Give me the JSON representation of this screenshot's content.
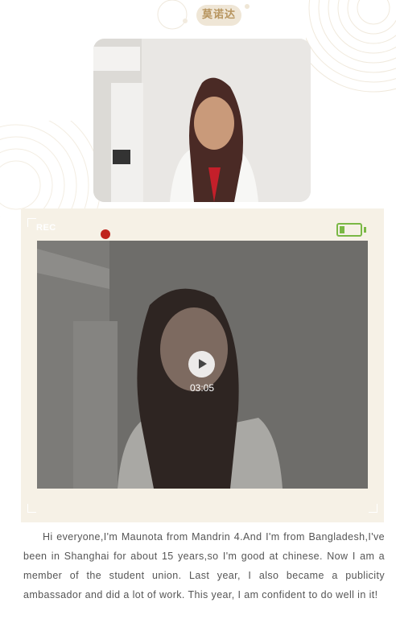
{
  "header": {
    "name": "莫诺达"
  },
  "photo": {
    "alt": "student portrait photo"
  },
  "video": {
    "rec_label": "REC",
    "duration": "03:05",
    "battery_level": 0.25,
    "colors": {
      "rec_dot": "#c0241d",
      "battery": "#7ab845",
      "panel": "#f6f1e6"
    }
  },
  "bio": {
    "text": "Hi everyone,I'm Maunota from Mandrin 4.And I'm from Bangladesh,I've been in Shanghai for about 15 years,so I'm good at chinese. Now I am a member of the student union. Last year, I also became a publicity ambassador and did a lot of work. This year, I am confident to do well in it!"
  },
  "accent_color": "#b7955f"
}
